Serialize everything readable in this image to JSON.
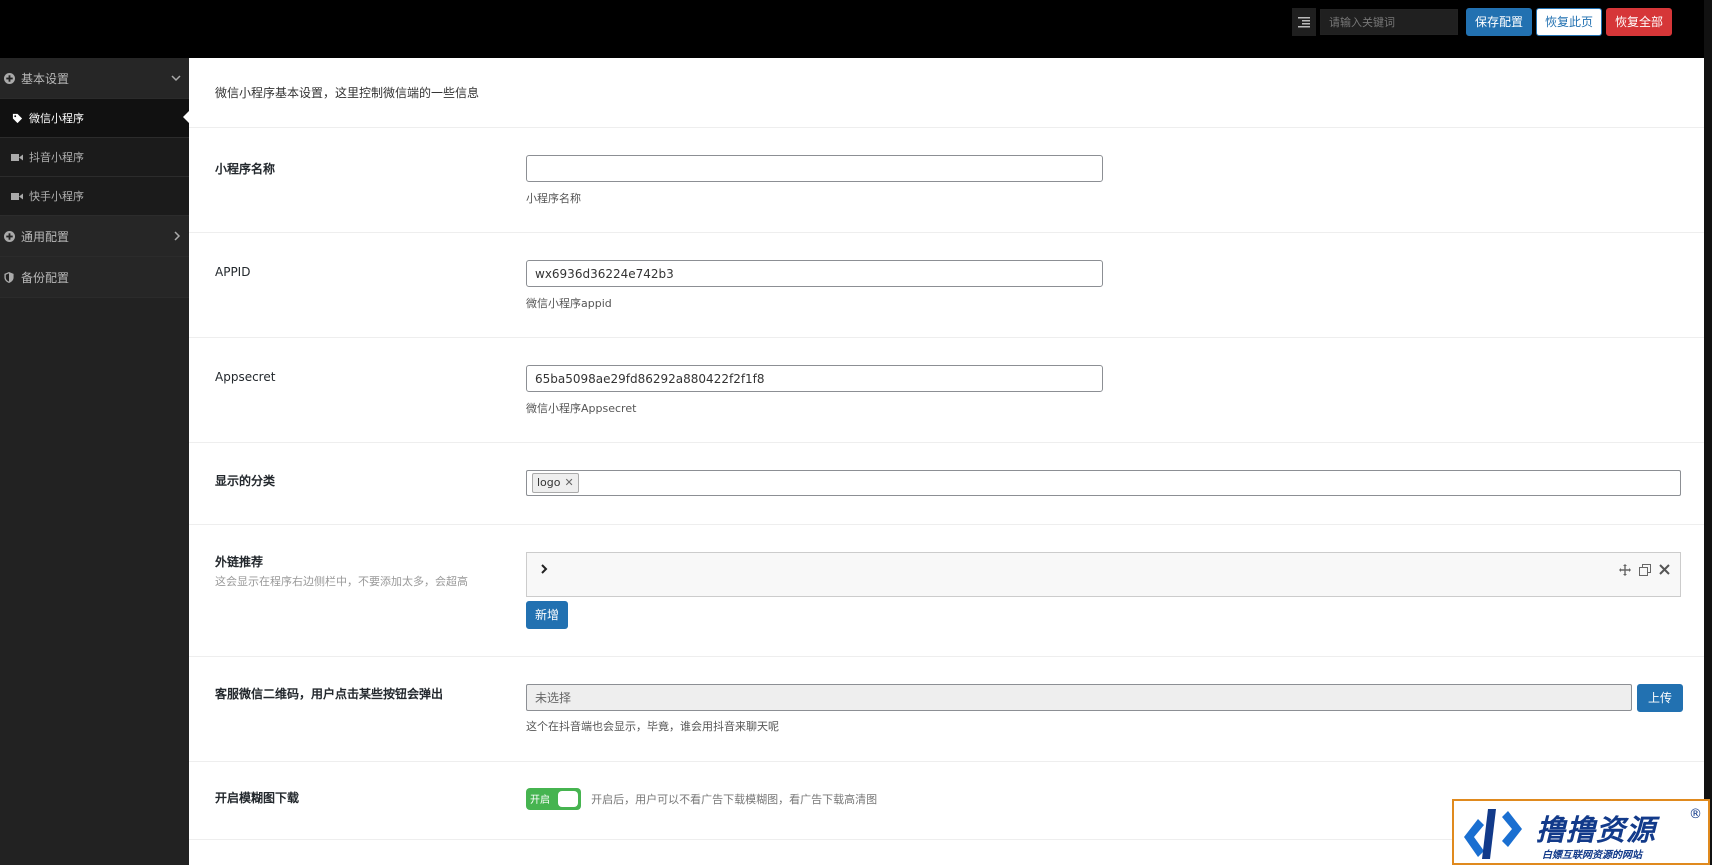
{
  "topbar": {
    "search_placeholder": "请输入关键词",
    "save_label": "保存配置",
    "restore_page_label": "恢复此页",
    "restore_all_label": "恢复全部"
  },
  "sidebar": {
    "items": [
      {
        "label": "基本设置",
        "icon": "plus-circle-icon"
      },
      {
        "label": "微信小程序",
        "icon": "tag-icon",
        "active": true
      },
      {
        "label": "抖音小程序",
        "icon": "video-icon"
      },
      {
        "label": "快手小程序",
        "icon": "video-icon"
      },
      {
        "label": "通用配置",
        "icon": "plus-circle-icon"
      },
      {
        "label": "备份配置",
        "icon": "shield-icon"
      }
    ]
  },
  "main": {
    "intro": "微信小程序基本设置，这里控制微信端的一些信息",
    "fields": {
      "name": {
        "label": "小程序名称",
        "value": "",
        "help": "小程序名称"
      },
      "appid": {
        "label": "APPID",
        "value": "wx6936d36224e742b3",
        "help": "微信小程序appid"
      },
      "secret": {
        "label": "Appsecret",
        "value": "65ba5098ae29fd86292a880422f2f1f8",
        "help": "微信小程序Appsecret"
      },
      "categories": {
        "label": "显示的分类",
        "tags": [
          "logo"
        ]
      },
      "links": {
        "label": "外链推荐",
        "sublabel": "这会显示在程序右边侧栏中，不要添加太多，会超高",
        "add_label": "新增"
      },
      "qrcode": {
        "label": "客服微信二维码，用户点击某些按钮会弹出",
        "value": "未选择",
        "upload_label": "上传",
        "help": "这个在抖音端也会显示，毕竟，谁会用抖音来聊天呢"
      },
      "blur": {
        "label": "开启模糊图下载",
        "switch_label": "开启",
        "enabled": true,
        "help": "开启后，用户可以不看广告下载模糊图，看广告下载高清图"
      }
    }
  },
  "watermark": {
    "title": "撸撸资源",
    "reg": "®",
    "subtitle": "白嫖互联网资源的网站"
  },
  "colors": {
    "primary": "#2271b1",
    "danger": "#d63638",
    "switch_on": "#46b450",
    "sidebar_bg": "#222222"
  }
}
